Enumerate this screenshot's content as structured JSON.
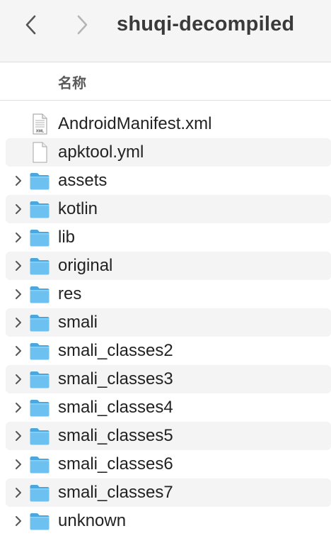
{
  "toolbar": {
    "title": "shuqi-decompiled",
    "back_icon": "chevron-left-icon",
    "forward_icon": "chevron-right-icon"
  },
  "header": {
    "name_column": "名称"
  },
  "colors": {
    "folder_body": "#6cc1f0",
    "folder_tab": "#4aa8e0",
    "stripe": "#f4f4f4",
    "toolbar_bg": "#f5f5f5"
  },
  "files": [
    {
      "name": "AndroidManifest.xml",
      "type": "xml-file",
      "expandable": false
    },
    {
      "name": "apktool.yml",
      "type": "document-file",
      "expandable": false
    },
    {
      "name": "assets",
      "type": "folder",
      "expandable": true
    },
    {
      "name": "kotlin",
      "type": "folder",
      "expandable": true
    },
    {
      "name": "lib",
      "type": "folder",
      "expandable": true
    },
    {
      "name": "original",
      "type": "folder",
      "expandable": true
    },
    {
      "name": "res",
      "type": "folder",
      "expandable": true
    },
    {
      "name": "smali",
      "type": "folder",
      "expandable": true
    },
    {
      "name": "smali_classes2",
      "type": "folder",
      "expandable": true
    },
    {
      "name": "smali_classes3",
      "type": "folder",
      "expandable": true
    },
    {
      "name": "smali_classes4",
      "type": "folder",
      "expandable": true
    },
    {
      "name": "smali_classes5",
      "type": "folder",
      "expandable": true
    },
    {
      "name": "smali_classes6",
      "type": "folder",
      "expandable": true
    },
    {
      "name": "smali_classes7",
      "type": "folder",
      "expandable": true
    },
    {
      "name": "unknown",
      "type": "folder",
      "expandable": true
    }
  ]
}
